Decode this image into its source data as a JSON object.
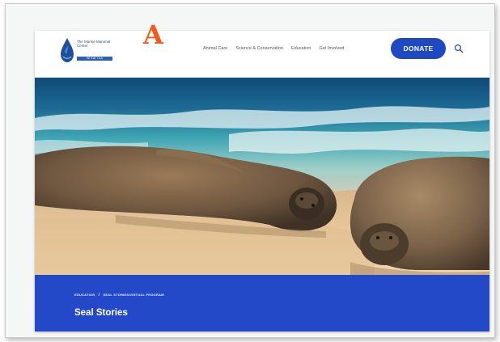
{
  "annotation": {
    "marker_label": "A",
    "marker_color": "#f05a1a"
  },
  "header": {
    "logo_text": "The Marine Mammal Center",
    "logo_subtext": "KE KAI ʻOLA",
    "nav": [
      {
        "label": "Animal Care"
      },
      {
        "label": "Science & Conservation"
      },
      {
        "label": "Education"
      },
      {
        "label": "Get Involved"
      }
    ],
    "donate_label": "DONATE",
    "search_icon": "search-icon"
  },
  "hero": {
    "image_subject": "Two Hawaiian monk seals resting on a sandy beach with ocean waves"
  },
  "banner": {
    "breadcrumb": [
      {
        "label": "EDUCATION"
      },
      {
        "label": "SEAL STORIES/VIRTUAL PROGRAM"
      }
    ],
    "breadcrumb_separator": "/",
    "title": "Seal Stories"
  },
  "colors": {
    "brand_blue": "#1e49c2",
    "banner_blue": "#2449c8"
  }
}
